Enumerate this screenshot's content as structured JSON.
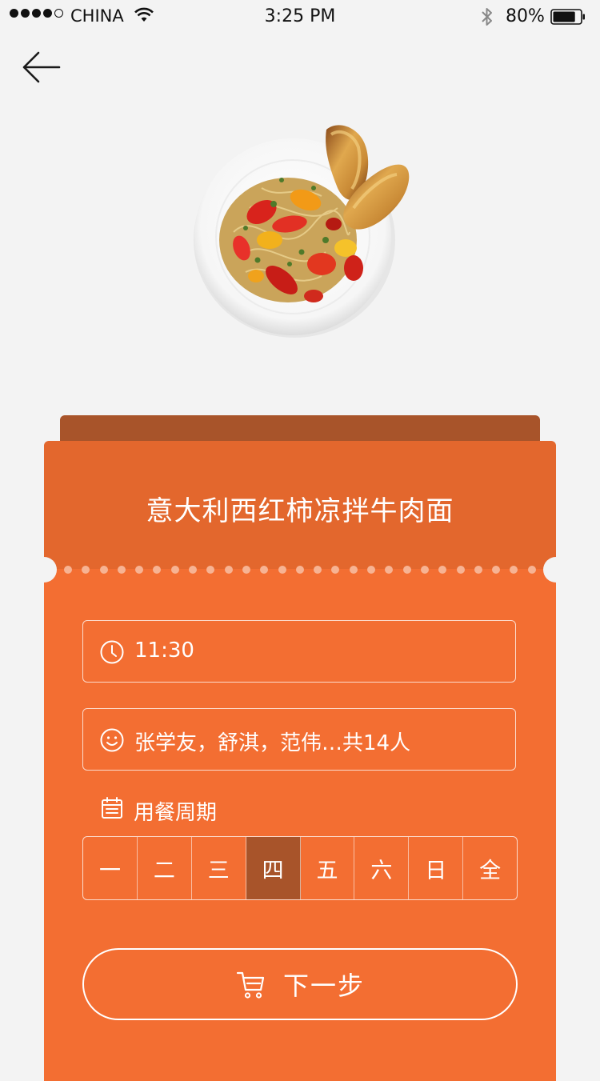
{
  "status_bar": {
    "carrier": "CHINA",
    "time": "3:25 PM",
    "battery": "80%",
    "battery_level": 0.8
  },
  "dish": {
    "title": "意大利西红柿凉拌牛肉面"
  },
  "form": {
    "time_value": "11:30",
    "diners_value": "张学友，舒淇，范伟…共14人",
    "period_label": "用餐周期",
    "days": [
      "一",
      "二",
      "三",
      "四",
      "五",
      "六",
      "日",
      "全"
    ],
    "selected_day": "四"
  },
  "next_button": {
    "label": "下一步"
  },
  "colors": {
    "ticket_header": "#e3672d",
    "ticket_body": "#f36e32",
    "ticket_back": "#a8542a",
    "selected_day": "#a8542a",
    "background": "#f3f3f3"
  }
}
